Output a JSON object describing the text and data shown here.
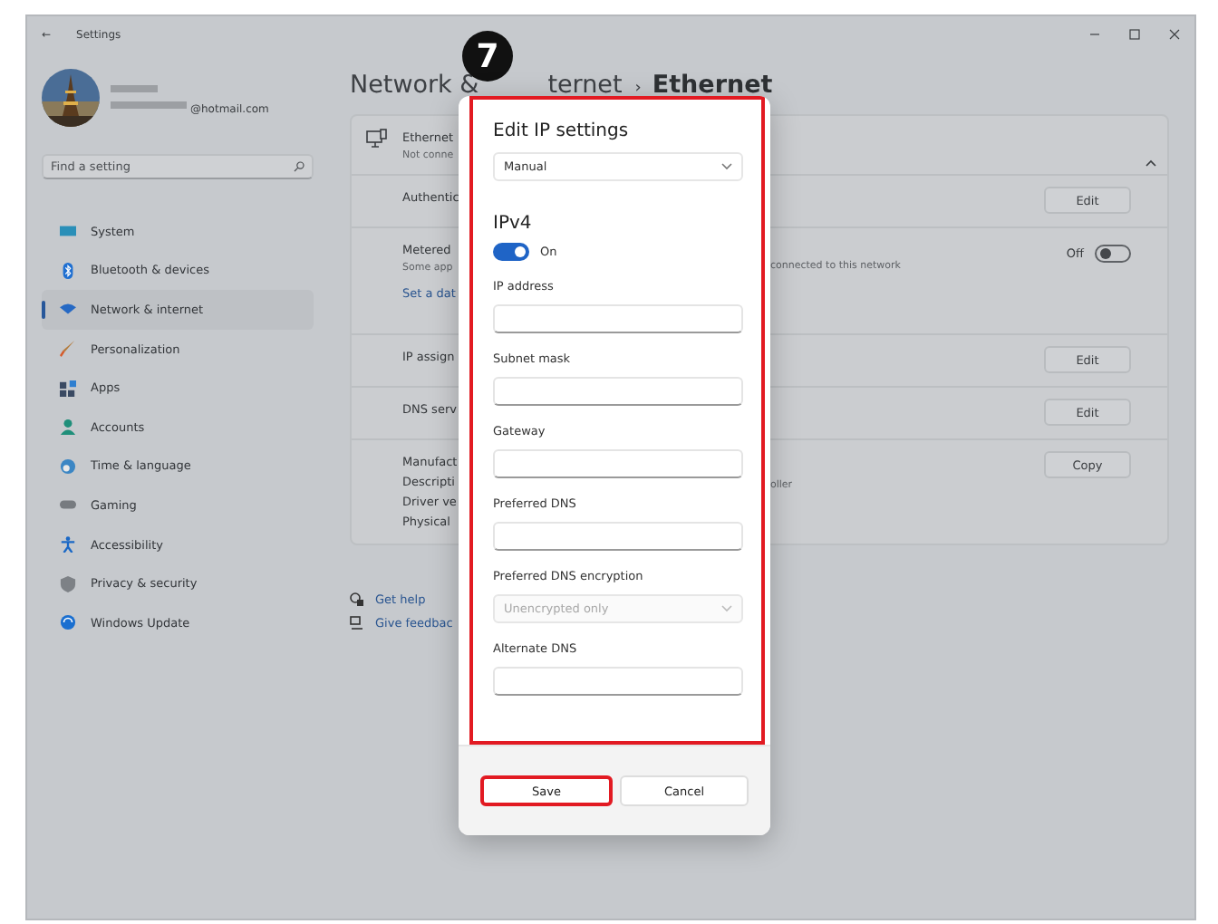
{
  "badge": "7",
  "window": {
    "back": "←",
    "title": "Settings",
    "controls": [
      {
        "kind": "minimize"
      },
      {
        "kind": "maximize"
      },
      {
        "kind": "close"
      }
    ]
  },
  "profile": {
    "email": "@hotmail.com"
  },
  "search": {
    "placeholder": "Find a setting"
  },
  "nav": [
    {
      "label": "System",
      "kind": "system",
      "selected": false
    },
    {
      "label": "Bluetooth & devices",
      "kind": "bluetooth",
      "selected": false
    },
    {
      "label": "Network & internet",
      "kind": "network",
      "selected": true
    },
    {
      "label": "Personalization",
      "kind": "brush",
      "selected": false
    },
    {
      "label": "Apps",
      "kind": "apps",
      "selected": false
    },
    {
      "label": "Accounts",
      "kind": "person",
      "selected": false
    },
    {
      "label": "Time & language",
      "kind": "globe",
      "selected": false
    },
    {
      "label": "Gaming",
      "kind": "gamepad",
      "selected": false
    },
    {
      "label": "Accessibility",
      "kind": "accessibility",
      "selected": false
    },
    {
      "label": "Privacy & security",
      "kind": "shield",
      "selected": false
    },
    {
      "label": "Windows Update",
      "kind": "update",
      "selected": false
    }
  ],
  "breadcrumb": {
    "parts": [
      "Network &",
      "ternet"
    ],
    "separator": "›",
    "current": "Ethernet"
  },
  "ethernet": {
    "title": "Ethernet",
    "subtitle": "Not conne",
    "expanded": true,
    "rows": [
      {
        "kind": "button",
        "labels": [
          "Authentic"
        ],
        "button": "Edit"
      },
      {
        "kind": "toggle",
        "labels": [
          "Metered"
        ],
        "sublabel": "Some app",
        "detail": "connected to this network",
        "link": "Set a dat",
        "toggle": {
          "on": false,
          "label": "Off"
        }
      },
      {
        "kind": "button",
        "labels": [
          "IP assign"
        ],
        "button": "Edit"
      },
      {
        "kind": "button",
        "labels": [
          "DNS serv"
        ],
        "button": "Edit"
      },
      {
        "kind": "button",
        "labels": [
          "Manufact",
          "Descripti",
          "Driver ve",
          "Physical"
        ],
        "detail": "oller",
        "button": "Copy"
      }
    ]
  },
  "help": [
    {
      "label": "Get help"
    },
    {
      "label": "Give feedbac"
    }
  ],
  "dialog": {
    "title": "Edit IP settings",
    "mode": "Manual",
    "section": "IPv4",
    "toggle": {
      "on": true,
      "label": "On"
    },
    "fields": [
      {
        "kind": "text",
        "label": "IP address"
      },
      {
        "kind": "text",
        "label": "Subnet mask"
      },
      {
        "kind": "text",
        "label": "Gateway"
      },
      {
        "kind": "text",
        "label": "Preferred DNS"
      },
      {
        "kind": "select",
        "label": "Preferred DNS encryption",
        "value": "Unencrypted only",
        "disabled": true
      },
      {
        "kind": "text",
        "label": "Alternate DNS"
      }
    ],
    "buttons": [
      {
        "label": "Save",
        "highlighted": true
      },
      {
        "label": "Cancel",
        "highlighted": false
      }
    ]
  }
}
